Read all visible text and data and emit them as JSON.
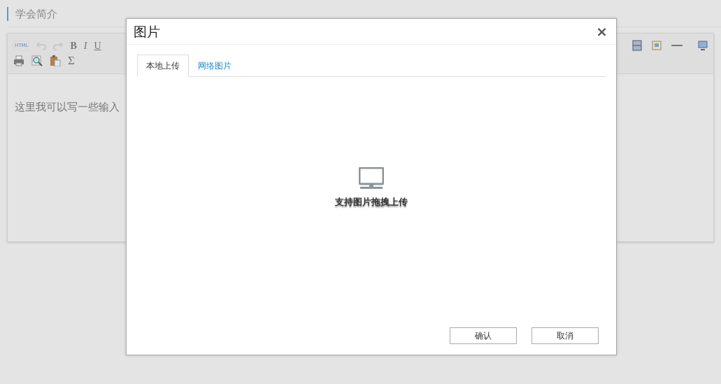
{
  "section_title": "学会简介",
  "editor": {
    "toolbar": {
      "html_label": "HTML",
      "bold": "B",
      "italic": "I",
      "underline": "U",
      "formula": "Σ"
    },
    "content": "这里我可以写一些输入"
  },
  "dialog": {
    "title": "图片",
    "close": "×",
    "tabs": [
      {
        "label": "本地上传",
        "selected": true
      },
      {
        "label": "网络图片",
        "selected": false
      }
    ],
    "upload_hint": "支持图片拖拽上传",
    "buttons": [
      "确认",
      "取消"
    ]
  }
}
